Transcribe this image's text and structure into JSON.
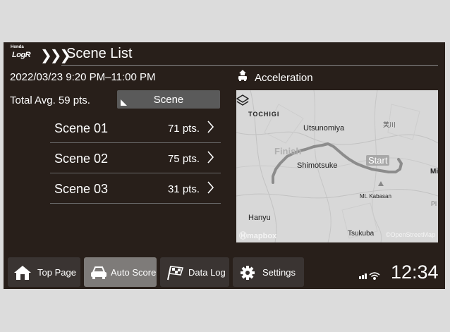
{
  "header": {
    "logo_brand": "Honda",
    "logo_mark": "LogR",
    "title": "Scene List"
  },
  "session": {
    "date_range": "2022/03/23 9:20 PM–11:00 PM",
    "total_avg": "Total Avg. 59 pts."
  },
  "scene_button": {
    "label": "Scene"
  },
  "scenes": [
    {
      "name": "Scene 01",
      "points": "71 pts."
    },
    {
      "name": "Scene 02",
      "points": "75 pts."
    },
    {
      "name": "Scene 03",
      "points": "31 pts."
    }
  ],
  "metric": {
    "label": "Acceleration",
    "icon": "car-acceleration-icon"
  },
  "map": {
    "labels": {
      "tochigi": "TOCHIGI",
      "utsunomiya": "Utsunomiya",
      "shimotsuke": "Shimotsuke",
      "hanyu": "Hanyu",
      "tsukuba": "Tsukuba",
      "mt_kabasan": "Mt. Kabasan",
      "kanji": "芙川",
      "edge_mi": "Mi",
      "edge_pl": "Pl"
    },
    "finish_label": "Finish",
    "start_label": "Start",
    "attribution_left": "mapbox",
    "attribution_right": "©OpenStreetMap",
    "route_color": "#8c8c8c"
  },
  "taskbar": {
    "items": [
      {
        "label": "Top Page",
        "icon": "home-icon",
        "active": false
      },
      {
        "label": "Auto Score",
        "icon": "car-icon",
        "active": true
      },
      {
        "label": "Data Log",
        "icon": "checkered-flag-icon",
        "active": false
      },
      {
        "label": "Settings",
        "icon": "gear-icon",
        "active": false
      }
    ]
  },
  "status": {
    "signal_icon": "signal-icon",
    "wifi_icon": "wifi-icon",
    "time": "12:34"
  }
}
